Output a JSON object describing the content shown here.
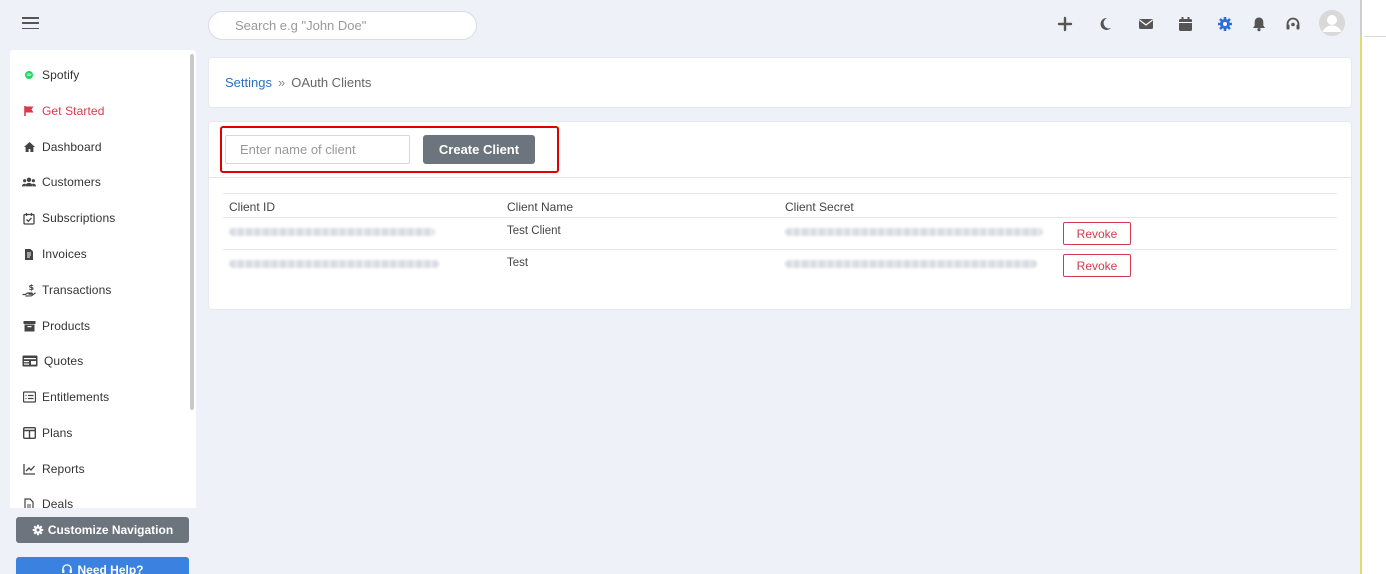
{
  "header": {
    "search_placeholder": "Search e.g \"John Doe\"",
    "icons": [
      "plus-icon",
      "moon-icon",
      "mail-icon",
      "calendar-icon",
      "gear-icon",
      "bell-icon",
      "headset-icon",
      "user-avatar"
    ]
  },
  "sidebar": {
    "items": [
      {
        "label": "Spotify",
        "icon": "spotify-dot-icon"
      },
      {
        "label": "Get Started",
        "icon": "flag-icon"
      },
      {
        "label": "Dashboard",
        "icon": "home-icon"
      },
      {
        "label": "Customers",
        "icon": "users-icon"
      },
      {
        "label": "Subscriptions",
        "icon": "calendar-check-icon"
      },
      {
        "label": "Invoices",
        "icon": "file-invoice-icon"
      },
      {
        "label": "Transactions",
        "icon": "hand-dollar-icon"
      },
      {
        "label": "Products",
        "icon": "archive-icon"
      },
      {
        "label": "Quotes",
        "icon": "quote-card-icon"
      },
      {
        "label": "Entitlements",
        "icon": "list-icon"
      },
      {
        "label": "Plans",
        "icon": "columns-icon"
      },
      {
        "label": "Reports",
        "icon": "chart-icon"
      },
      {
        "label": "Deals",
        "icon": "file-icon"
      }
    ],
    "customize_label": "Customize Navigation",
    "help_label": "Need Help?"
  },
  "breadcrumb": {
    "parent": "Settings",
    "separator": "»",
    "current": "OAuth Clients"
  },
  "create": {
    "placeholder": "Enter name of client",
    "button_label": "Create Client"
  },
  "table": {
    "headers": [
      "Client ID",
      "Client Name",
      "Client Secret"
    ],
    "rows": [
      {
        "client_name": "Test Client",
        "action": "Revoke"
      },
      {
        "client_name": "Test",
        "action": "Revoke"
      }
    ]
  },
  "colors": {
    "accent_blue": "#2e6fc0",
    "danger_red": "#d33a4c",
    "button_gray": "#6c757d",
    "highlight_red": "#e00000"
  }
}
